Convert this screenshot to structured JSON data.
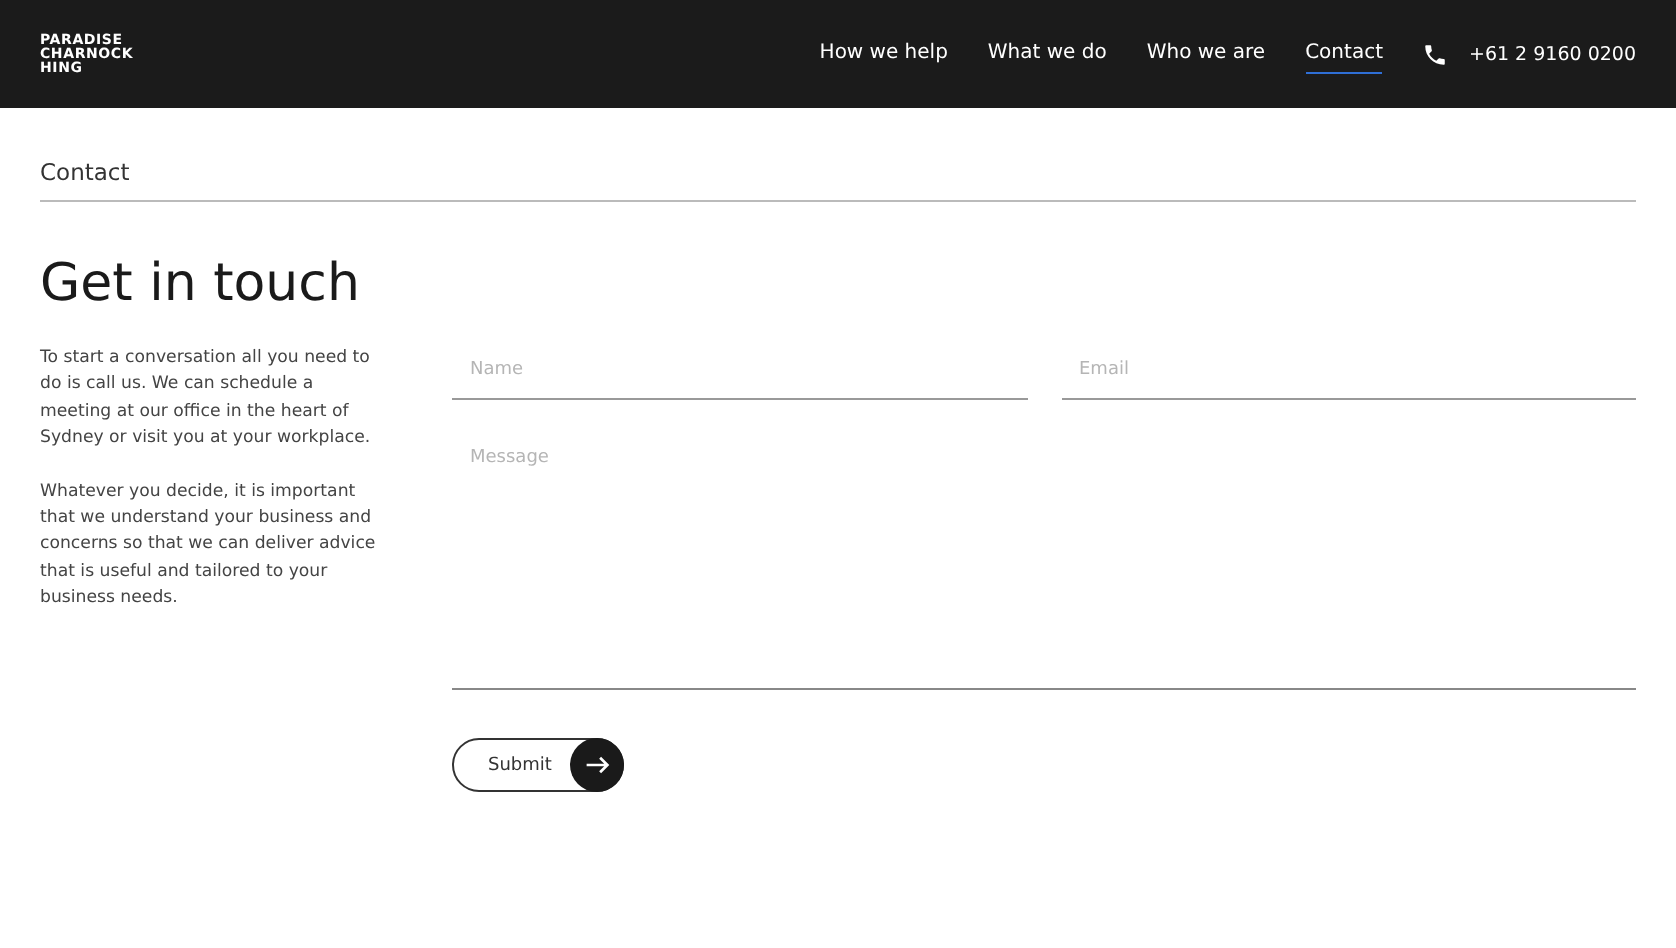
{
  "header": {
    "logo_lines": [
      "PARADISE",
      "CHARNOCK",
      "HING"
    ],
    "nav": [
      {
        "label": "How we help",
        "selected": false
      },
      {
        "label": "What we do",
        "selected": false
      },
      {
        "label": "Who we are",
        "selected": false
      },
      {
        "label": "Contact",
        "selected": true
      }
    ],
    "phone": "+61 2 9160 0200"
  },
  "breadcrumb": "Contact",
  "title": "Get in touch",
  "paragraphs": [
    "To start a conversation all you need to do is call us. We can schedule a meeting at our office in the heart of Sydney or visit you at your workplace.",
    "Whatever you decide, it is important that we understand your business and concerns so that we can deliver advice that is useful and tailored to your business needs."
  ],
  "form": {
    "fields": [
      {
        "placeholder": "Name"
      },
      {
        "placeholder": "Email"
      }
    ],
    "message": {
      "placeholder": "Message"
    },
    "submit": "Submit"
  }
}
